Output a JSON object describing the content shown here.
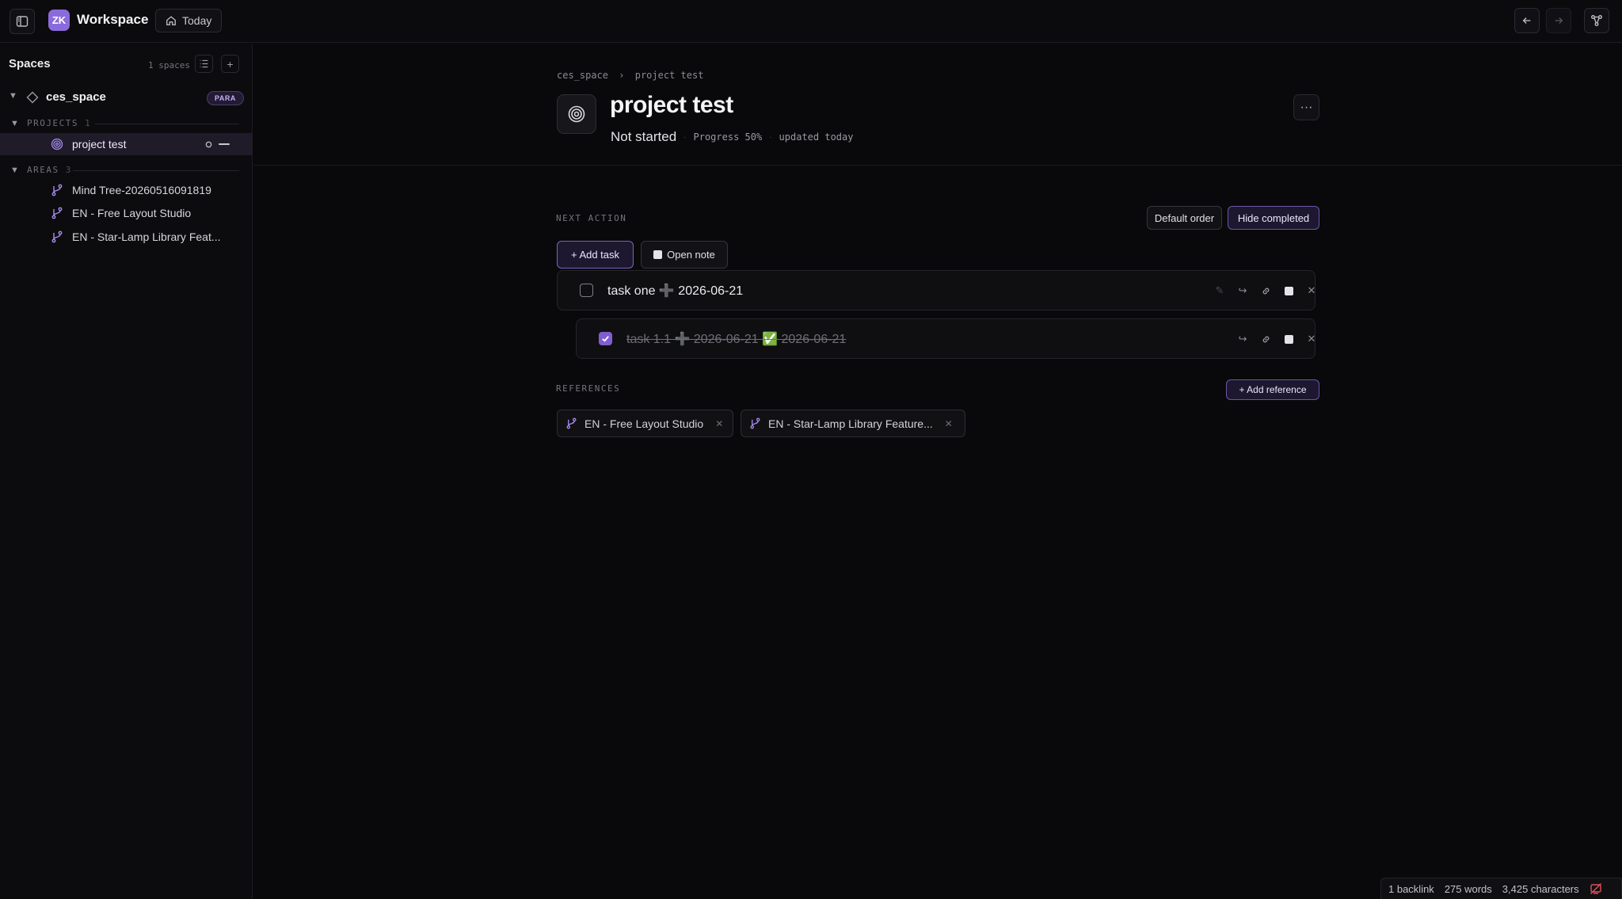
{
  "topbar": {
    "avatar_initials": "ZK",
    "workspace_name": "Workspace",
    "today_label": "Today"
  },
  "sidebar": {
    "title": "Spaces",
    "space_count": "1 spaces",
    "space": {
      "name": "ces_space",
      "badge": "PARA"
    },
    "projects": {
      "label": "PROJECTS",
      "count": "1",
      "items": [
        {
          "label": "project test"
        }
      ]
    },
    "areas": {
      "label": "AREAS",
      "count": "3",
      "items": [
        {
          "label": "Mind Tree-20260516091819"
        },
        {
          "label": "EN - Free Layout Studio"
        },
        {
          "label": "EN - Star-Lamp Library Feat..."
        }
      ]
    }
  },
  "main": {
    "breadcrumb": {
      "space": "ces_space",
      "sep": "›",
      "page": "project test"
    },
    "title": "project test",
    "status": "Not started",
    "progress": "Progress 50%",
    "progress_value": 0.5,
    "updated": "updated today",
    "next_action": {
      "label": "NEXT ACTION",
      "default_order": "Default order",
      "hide_completed": "Hide completed",
      "add_task": "+ Add task",
      "open_note": "Open note",
      "tasks": [
        {
          "text": "task one ➕ 2026-06-21",
          "done": false
        },
        {
          "text": "task 1.1 ➕ 2026-06-21 ✅ 2026-06-21",
          "done": true
        }
      ]
    },
    "references": {
      "label": "REFERENCES",
      "add_label": "+ Add reference",
      "items": [
        {
          "label": "EN - Free Layout Studio"
        },
        {
          "label": "EN - Star-Lamp Library Feature..."
        }
      ]
    }
  },
  "statusbar": {
    "backlinks": "1 backlink",
    "words": "275 words",
    "characters": "3,425 characters"
  },
  "colors": {
    "accent": "#7f5ecf",
    "background": "#0a0a0c"
  }
}
